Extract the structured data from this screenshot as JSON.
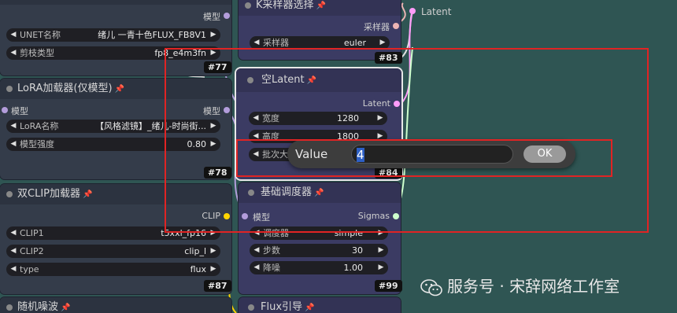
{
  "nodes": {
    "unet": {
      "out_label": "模型",
      "w1_label": "UNET名称",
      "w1_value": "绪儿 一青十色FLUX_FB8V1",
      "w2_label": "剪枝类型",
      "w2_value": "fp8_e4m3fn",
      "badge": "#77"
    },
    "lora": {
      "title": "LoRA加载器(仅模型)",
      "in_label": "模型",
      "out_label": "模型",
      "w1_label": "LoRA名称",
      "w1_value": "【风格滤镜】_绪儿-时尚街...",
      "w2_label": "模型强度",
      "w2_value": "0.80",
      "badge": "#78"
    },
    "dualclip": {
      "title": "双CLIP加载器",
      "out_label": "CLIP",
      "w1_label": "CLIP1",
      "w1_value": "t5xxl_fp16",
      "w2_label": "CLIP2",
      "w2_value": "clip_l",
      "w3_label": "type",
      "w3_value": "flux",
      "badge": "#87"
    },
    "noise": {
      "title": "随机噪波"
    },
    "ksampler": {
      "title": "K采样器选择",
      "out_label": "采样器",
      "w1_label": "采样器",
      "w1_value": "euler",
      "badge": "#83"
    },
    "empty_latent": {
      "title": "空Latent",
      "out_label": "Latent",
      "w1_label": "宽度",
      "w1_value": "1280",
      "w2_label": "高度",
      "w2_value": "1800",
      "w3_label": "批次大小",
      "badge": "#84"
    },
    "scheduler": {
      "title": "基础调度器",
      "in_label": "模型",
      "out_label": "Sigmas",
      "w1_label": "调度器",
      "w1_value": "simple",
      "w2_label": "步数",
      "w2_value": "30",
      "w3_label": "降噪",
      "w3_value": "1.00",
      "badge": "#99"
    },
    "flux_guide": {
      "title": "Flux引导"
    },
    "right_node": {
      "out_label": "Latent"
    }
  },
  "dialog": {
    "label": "Value",
    "value": "4",
    "ok": "OK"
  },
  "watermark": "服务号 · 宋辞网络工作室",
  "colors": {
    "background": "#2f5553",
    "node": "#343c4a",
    "node_purple": "#3b3b63",
    "model_socket": "#b39ddb",
    "clip_socket": "#ffd500",
    "latent_socket": "#ff9cf9",
    "sampler_socket": "#ecb4b4",
    "sigmas_socket": "#cdffcd",
    "highlight": "#e02424"
  }
}
